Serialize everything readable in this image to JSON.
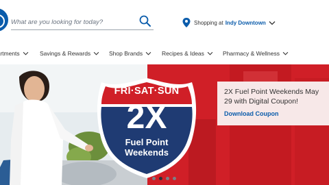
{
  "header": {
    "search": {
      "placeholder": "What are you looking for today?"
    },
    "store": {
      "prefix": "Shopping at",
      "location": "Indy Downtown"
    }
  },
  "nav": {
    "items": [
      {
        "label": "Departments"
      },
      {
        "label": "Savings & Rewards"
      },
      {
        "label": "Shop Brands"
      },
      {
        "label": "Recipes & Ideas"
      },
      {
        "label": "Pharmacy & Wellness"
      }
    ]
  },
  "hero": {
    "shield": {
      "days": "FRI·SAT·SUN",
      "multiplier": "2X",
      "line1": "Fuel Point",
      "line2": "Weekends"
    },
    "promo": {
      "title": "2X Fuel Point Weekends May 29 with Digital Coupon!",
      "link": "Download Coupon"
    },
    "carousel": {
      "total": 4,
      "active": 1
    }
  },
  "colors": {
    "brand_blue": "#0b5cab",
    "hero_red": "#d01f27",
    "shield_navy": "#1f3b73"
  }
}
